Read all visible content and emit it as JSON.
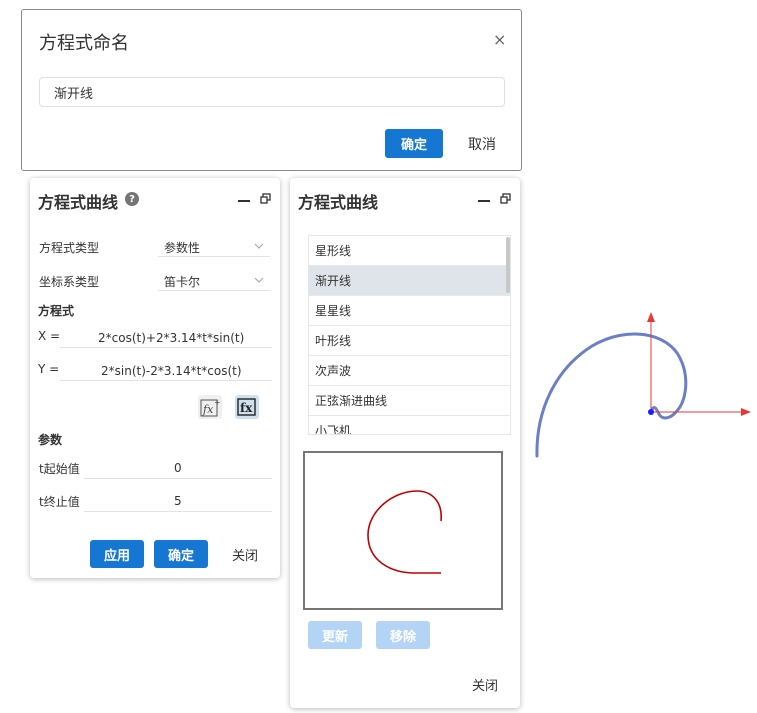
{
  "name_dialog": {
    "title": "方程式命名",
    "close_glyph": "×",
    "input_value": "渐开线",
    "ok_label": "确定",
    "cancel_label": "取消"
  },
  "curve_panel": {
    "title": "方程式曲线",
    "help_glyph": "?",
    "type_label": "方程式类型",
    "type_value": "参数性",
    "coord_label": "坐标系类型",
    "coord_value": "笛卡尔",
    "equation_section": "方程式",
    "x_label": "X =",
    "x_expr": "2*cos(t)+2*3.14*t*sin(t)",
    "y_label": "Y =",
    "y_expr": "2*sin(t)-2*3.14*t*cos(t)",
    "params_section": "参数",
    "t_start_label": "t起始值",
    "t_start_value": "0",
    "t_end_label": "t终止值",
    "t_end_value": "5",
    "apply_label": "应用",
    "ok_label": "确定",
    "close_label": "关闭"
  },
  "library_panel": {
    "title": "方程式曲线",
    "items": [
      "星形线",
      "渐开线",
      "星星线",
      "叶形线",
      "次声波",
      "正弦渐进曲线",
      "小飞机"
    ],
    "selected_index": 1,
    "update_label": "更新",
    "remove_label": "移除",
    "close_label": "关闭"
  },
  "colors": {
    "primary": "#1677d2",
    "primary_disabled": "#b3d4f5",
    "preview_curve": "#c00000",
    "viewport_curve": "#6a7fc9",
    "axis": "#e53935"
  },
  "icons": {
    "close": "close-icon",
    "help": "help-icon",
    "minimize": "minimize-icon",
    "restore": "restore-icon",
    "fx_insert": "fx-insert-icon",
    "fx": "fx-icon"
  }
}
